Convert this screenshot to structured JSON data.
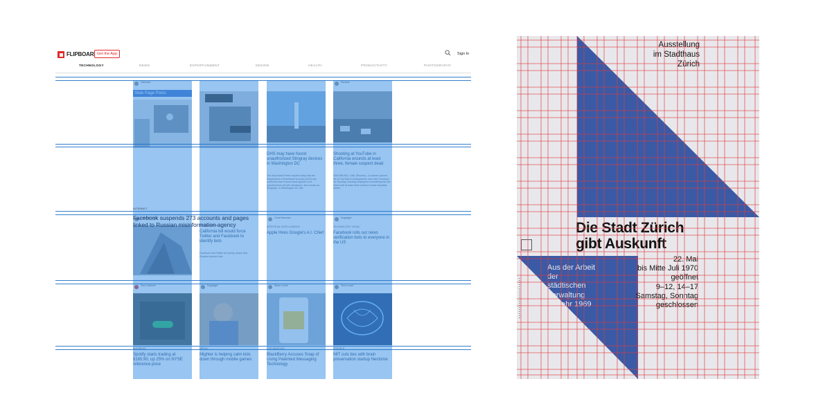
{
  "flipboard": {
    "logo": "FLIPBOARD",
    "get_app": "Get the App",
    "sign_in": "Sign In",
    "categories": [
      "TECHNOLOGY",
      "NEWS",
      "ENTERTAINMENT",
      "DESIGN",
      "HEALTH",
      "PRODUCTIVITY",
      "PHOTOGRAPHY"
    ],
    "active_category": "TECHNOLOGY",
    "columns": [
      {
        "source": "Gizmodo",
        "card1_header": "Slide Page Posts",
        "card1_tag": "INTERNET",
        "card1_title": "Facebook suspends 273 accounts and pages linked to Russian misinformation agency",
        "card2_source": "Gizmodo Cam",
        "card3_source": "Tom Coldwell",
        "card3_tag": "BUSINESS",
        "card3_title": "Spotify starts trading at $165.90, up 25% on NYSE reference price"
      },
      {
        "card2_tag": "SOCIAL MEDIA",
        "card2_title": "California bill would force Twitter and Facebook to identify bots",
        "card2_text": "Facebook and Twitter are plenty aware that Russian-backed bots",
        "card3_source": "Engadget",
        "card3_tag": "MEDIA",
        "card3_title": "Mighter is helping calm kids down through mobile games"
      },
      {
        "card1_title": "DHS may have found unauthorized Stingray devices in Washington DC",
        "card1_text": "The Associated Press reports today that the Department of Homeland Security (DHS) has confirmed that it found what appear to be unauthorized cell-site simulators, also known as Stingrays, in Washington DC last",
        "card2_source": "Chris Newman",
        "card2_tag": "ARTIFICIAL INTELLIGENCE",
        "card2_title": "Apple Hires Google's A.I. Chief",
        "card3_source": "Steve Losch",
        "card3_tag": "LOS ANGELES",
        "card3_title": "BlackBerry Accuses Snap of Using Patented Messaging Technology"
      },
      {
        "source": "Reuters",
        "card1_title": "Shooting at YouTube in California wounds at least three, female suspect dead",
        "card1_text": "SAN BRUNO, Calif. (Reuters) - A woman opened fire at YouTube's headquarters near San Francisco on Tuesday, sending employees scrambling into the street and at least three victims to local hospitals before",
        "card2_source": "Engadget",
        "card2_tag": "TECHNOLOGY LEGAL",
        "card2_title": "Facebook rolls out news verification bots to everyone in the US",
        "card3_source": "Tech Lunch",
        "card3_tag": "SCIENCE",
        "card3_title": "MIT cuts ties with brain preservation startup Nectome"
      }
    ]
  },
  "poster": {
    "exhibition": [
      "Ausstellung",
      "im Stadthaus",
      "Zürich"
    ],
    "headline": [
      "Die Stadt Zürich",
      "gibt Auskunft"
    ],
    "subtitle": [
      "Aus der Arbeit",
      "der",
      "städtischen",
      "Verwaltung",
      "im Jahr 1969"
    ],
    "dates": [
      "22. Mai",
      "bis Mitte Juli 1970",
      "geöffnet",
      "9–12, 14–17",
      "Samstag, Sonntag",
      "geschlossen"
    ],
    "colors": {
      "background": "#e8e8ec",
      "shape": "#3a5aa6",
      "grid": "#e23b3b"
    }
  },
  "overlay_color": "#4496e6"
}
